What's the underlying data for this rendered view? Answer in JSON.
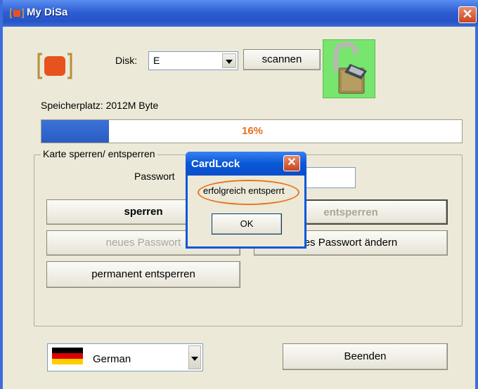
{
  "window": {
    "title": "My DiSa",
    "close_glyph": "✕"
  },
  "disk": {
    "label": "Disk:",
    "selected": "E",
    "scan_label": "scannen"
  },
  "storage": {
    "label": "Speicherplatz: 2012M Byte",
    "progress_percent": 16,
    "progress_text": "16%"
  },
  "lock_group": {
    "legend": "Karte sperren/ entsperren",
    "password_label": "Passwort",
    "password_value": "",
    "lock_label": "sperren",
    "unlock_label": "entsperren",
    "new_password_label": "neues Passwort",
    "change_password_label": "es Passwort ändern",
    "permanent_unlock_label": "permanent entsperren"
  },
  "language": {
    "selected": "German"
  },
  "exit_label": "Beenden",
  "dialog": {
    "title": "CardLock",
    "message": "erfolgreich entsperrt",
    "ok_label": "OK",
    "close_glyph": "✕"
  },
  "colors": {
    "accent": "#3b72d6",
    "progress_text": "#e86d1c",
    "lock_bg": "#77e56e"
  },
  "icons": {
    "app": "disa-logo-icon",
    "lock": "open-padlock-icon",
    "flag": "germany-flag-icon"
  }
}
